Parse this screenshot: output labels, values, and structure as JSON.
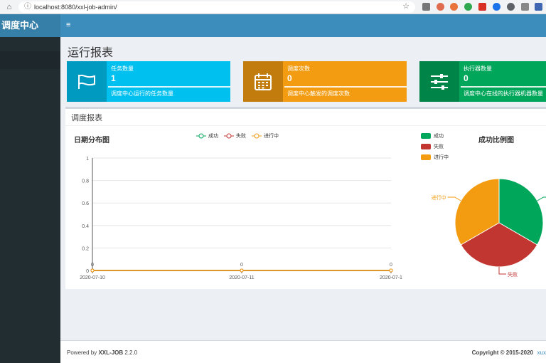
{
  "browser": {
    "url": "localhost:8080/xxl-job-admin/",
    "home_icon": "⌂",
    "star_icon": "☆"
  },
  "header": {
    "logo": "调度中心",
    "toggle_icon": "≡"
  },
  "page": {
    "title": "运行报表"
  },
  "info_boxes": [
    {
      "title": "任务数量",
      "value": "1",
      "desc": "调度中心运行的任务数量",
      "color": "#00c0ef",
      "icon": "flag-icon"
    },
    {
      "title": "调度次数",
      "value": "0",
      "desc": "调度中心触发的调度次数",
      "color": "#f39c12",
      "icon": "calendar-icon"
    },
    {
      "title": "执行器数量",
      "value": "0",
      "desc": "调度中心在线的执行器机器数量",
      "color": "#00a65a",
      "icon": "sliders-icon"
    }
  ],
  "report": {
    "panel_title": "调度报表",
    "line_chart_title": "日期分布图",
    "pie_chart_title": "成功比例图"
  },
  "chart_data": [
    {
      "type": "line",
      "title": "日期分布图",
      "x": [
        "2020-07-10",
        "2020-07-11",
        "2020-07-1"
      ],
      "ylim": [
        0,
        1
      ],
      "yticks": [
        "0",
        "0.2",
        "0.4",
        "0.6",
        "0.8",
        "1"
      ],
      "series": [
        {
          "name": "成功",
          "color": "#00a65a",
          "values": [
            0,
            0,
            0
          ]
        },
        {
          "name": "失败",
          "color": "#c23632",
          "values": [
            0,
            0,
            0
          ]
        },
        {
          "name": "进行中",
          "color": "#f39c12",
          "values": [
            0,
            0,
            0
          ]
        }
      ],
      "data_labels": [
        "0",
        "0",
        "0"
      ],
      "legend": "top-center",
      "grid": true
    },
    {
      "type": "pie",
      "title": "成功比例图",
      "labels": [
        "成功",
        "失败",
        "进行中"
      ],
      "values": [
        1,
        1,
        1
      ],
      "colors": [
        "#00a65a",
        "#c23632",
        "#f39c12"
      ],
      "legend": "top-left"
    }
  ],
  "footer": {
    "powered_prefix": "Powered by ",
    "brand": "XXL-JOB",
    "version": " 2.2.0",
    "copyright": "Copyright © 2015-2020",
    "link": "xux"
  }
}
